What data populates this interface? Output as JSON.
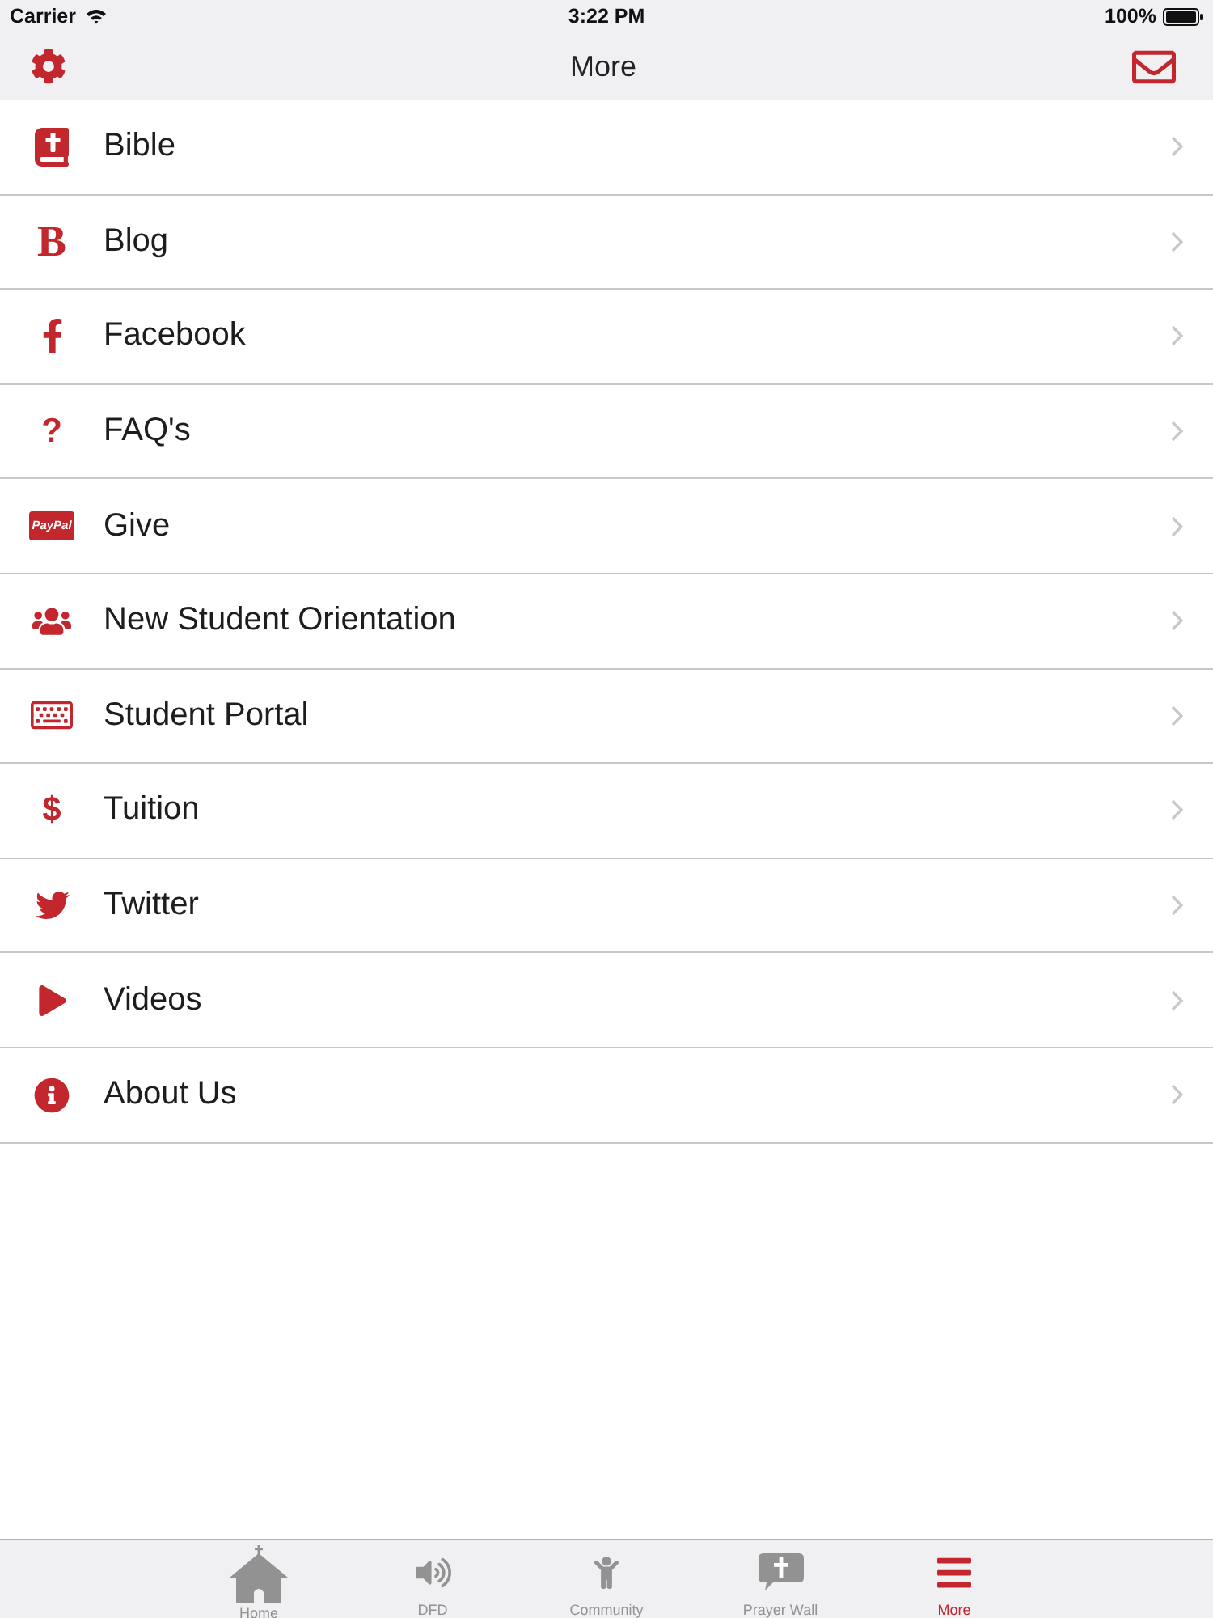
{
  "status_bar": {
    "carrier": "Carrier",
    "time": "3:22 PM",
    "battery": "100%"
  },
  "nav_bar": {
    "title": "More"
  },
  "menu": [
    {
      "label": "Bible",
      "kind": "icon"
    },
    {
      "label": "Blog",
      "kind": "letter",
      "icon_text": "B"
    },
    {
      "label": "Facebook",
      "kind": "icon"
    },
    {
      "label": "FAQ's",
      "kind": "glyph",
      "icon_text": "?"
    },
    {
      "label": "Give",
      "kind": "badge",
      "icon_text": "PayPal"
    },
    {
      "label": "New Student Orientation",
      "kind": "icon"
    },
    {
      "label": "Student Portal",
      "kind": "icon"
    },
    {
      "label": "Tuition",
      "kind": "glyph",
      "icon_text": "$"
    },
    {
      "label": "Twitter",
      "kind": "icon"
    },
    {
      "label": "Videos",
      "kind": "icon"
    },
    {
      "label": "About Us",
      "kind": "icon"
    }
  ],
  "tab_bar": [
    {
      "label": "Home",
      "selected": false
    },
    {
      "label": "DFD",
      "selected": false
    },
    {
      "label": "Community",
      "selected": false
    },
    {
      "label": "Prayer Wall",
      "selected": false
    },
    {
      "label": "More",
      "selected": true
    }
  ]
}
